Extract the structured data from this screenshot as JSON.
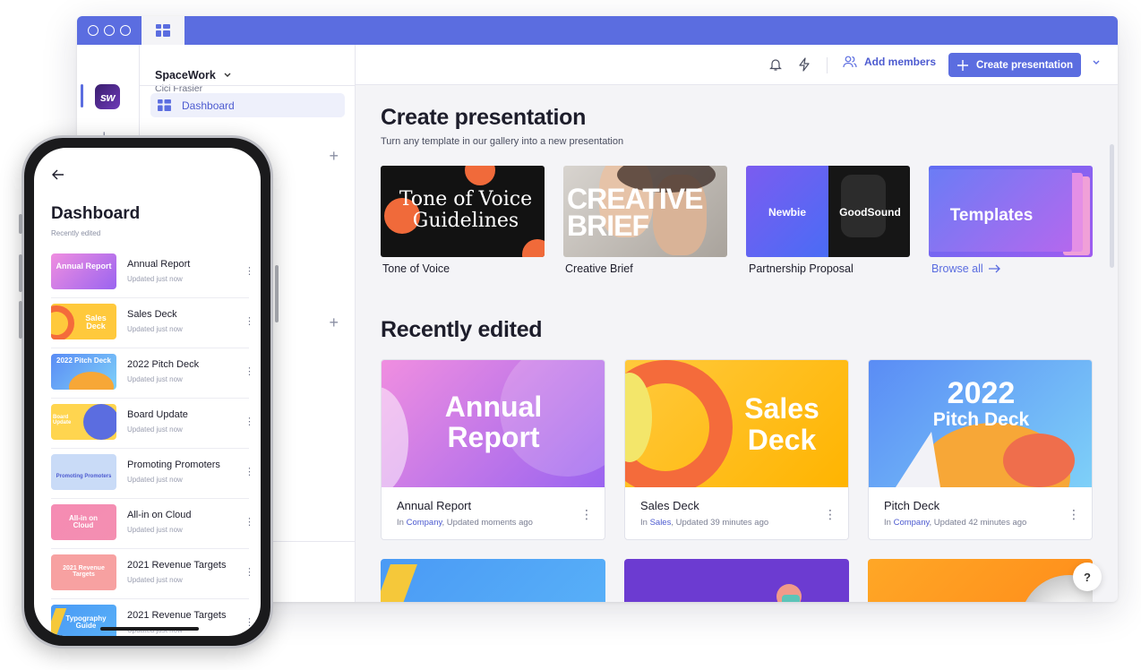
{
  "window": {
    "workspace": "SpaceWork",
    "user": "Cici Frasier",
    "logo_text": "sw",
    "sidebar": {
      "dashboard_label": "Dashboard"
    },
    "topbar": {
      "add_members": "Add members",
      "create_presentation": "Create presentation"
    },
    "create_section": {
      "title": "Create presentation",
      "subtitle": "Turn any template in our gallery into a new presentation",
      "templates": [
        {
          "label": "Tone of Voice",
          "thumb_text": "Tone of Voice Guidelines"
        },
        {
          "label": "Creative Brief",
          "thumb_text": "CREATIVE BRIEF"
        },
        {
          "label": "Partnership Proposal",
          "thumb_left": "Newbie",
          "thumb_right": "GoodSound"
        },
        {
          "label": "",
          "thumb_text": "Templates"
        }
      ],
      "browse_all": "Browse all"
    },
    "recent_section": {
      "title": "Recently edited",
      "cards": [
        {
          "title": "Annual Report",
          "prefix": "In",
          "folder": "Company",
          "updated": ", Updated moments ago",
          "thumb_line1": "Annual",
          "thumb_line2": "Report"
        },
        {
          "title": "Sales Deck",
          "prefix": "In",
          "folder": "Sales",
          "updated": ", Updated 39 minutes ago",
          "thumb_line1": "Sales",
          "thumb_line2": "Deck"
        },
        {
          "title": "Pitch Deck",
          "prefix": "In",
          "folder": "Company",
          "updated": ", Updated 42 minutes ago",
          "thumb_line1": "2022",
          "thumb_line2": "Pitch Deck"
        }
      ]
    },
    "help": "?"
  },
  "phone": {
    "title": "Dashboard",
    "subtitle": "Recently edited",
    "items": [
      {
        "name": "Annual Report",
        "updated": "Updated just now",
        "thumb": "Annual Report"
      },
      {
        "name": "Sales Deck",
        "updated": "Updated just now",
        "thumb": "Sales Deck"
      },
      {
        "name": "2022 Pitch Deck",
        "updated": "Updated just now",
        "thumb": "2022 Pitch Deck"
      },
      {
        "name": "Board Update",
        "updated": "Updated just now",
        "thumb": "Board Update"
      },
      {
        "name": "Promoting Promoters",
        "updated": "Updated just now",
        "thumb": "Promoting Promoters"
      },
      {
        "name": "All-in on Cloud",
        "updated": "Updated just now",
        "thumb": "All-in on Cloud"
      },
      {
        "name": "2021 Revenue Targets",
        "updated": "Updated just now",
        "thumb": "2021 Revenue Targets"
      },
      {
        "name": "2021 Revenue Targets",
        "updated": "Updated just now",
        "thumb": "Typography Guide"
      }
    ]
  },
  "colors": {
    "accent": "#5b6de0",
    "link": "#4d5bd0"
  }
}
